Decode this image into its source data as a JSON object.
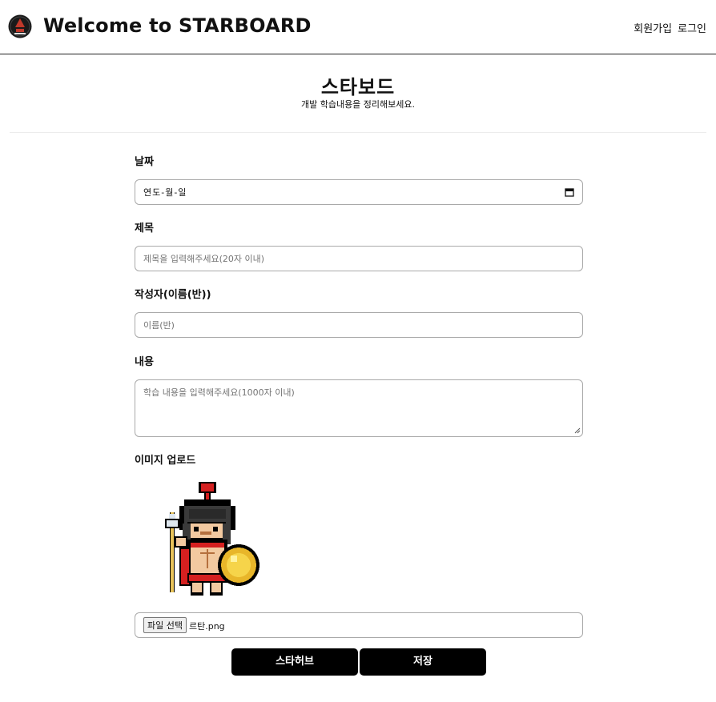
{
  "header": {
    "title": "Welcome to STARBOARD",
    "logo_icon": "sparta-logo-icon",
    "nav": {
      "signup": "회원가입",
      "login": "로그인"
    }
  },
  "page": {
    "title": "스타보드",
    "subtitle": "개발 학습내용을 정리해보세요."
  },
  "form": {
    "date": {
      "label": "날짜",
      "value": "연도-월-일",
      "icon": "calendar-icon"
    },
    "title": {
      "label": "제목",
      "placeholder": "제목을 입력해주세요(20자 이내)"
    },
    "author": {
      "label": "작성자(이름(반))",
      "placeholder": "이름(반)"
    },
    "content": {
      "label": "내용",
      "placeholder": "학습 내용을 입력해주세요(1000자 이내)"
    },
    "image": {
      "label": "이미지 업로드",
      "preview_icon": "spartan-warrior-pixel-image",
      "file_button": "파일 선택",
      "file_name": "르탄.png"
    }
  },
  "actions": {
    "starhub": "스타허브",
    "save": "저장"
  },
  "colors": {
    "button_bg": "#000000",
    "button_text": "#ffffff",
    "border": "#a9a9a9"
  }
}
